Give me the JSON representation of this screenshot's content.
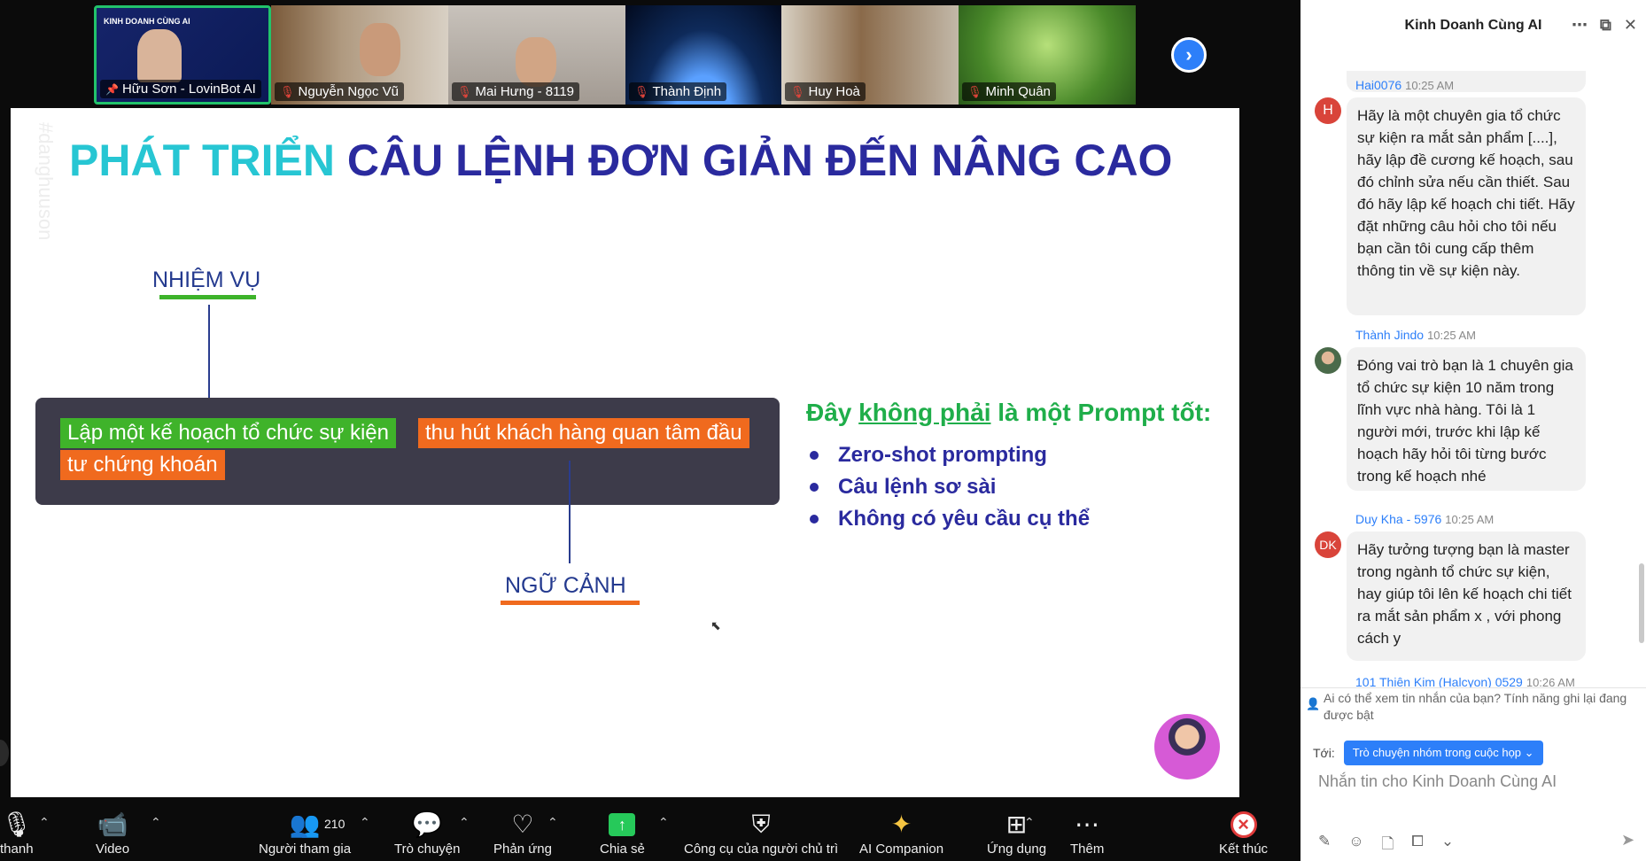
{
  "video_strip": {
    "participants": [
      {
        "name": "Hữu Sơn - LovinBot AI",
        "pinned": true,
        "muted": false,
        "bg": "#1a2a6a"
      },
      {
        "name": "Nguyễn Ngọc Vũ",
        "pinned": false,
        "muted": true,
        "bg": "#6b5b4a"
      },
      {
        "name": "Mai Hưng - 8119",
        "pinned": false,
        "muted": true,
        "bg": "#9a928a"
      },
      {
        "name": "Thành Định",
        "pinned": false,
        "muted": true,
        "bg": "#0e2a5a"
      },
      {
        "name": "Huy Hoà",
        "pinned": false,
        "muted": true,
        "bg": "#8a7a6a"
      },
      {
        "name": "Minh Quân",
        "pinned": false,
        "muted": true,
        "bg": "#4a8a2a"
      }
    ],
    "tile_logo": "KINH DOANH CÙNG AI"
  },
  "slide": {
    "watermark": "#danghuuson",
    "title_part1": "PHÁT TRIỂN",
    "title_part2": "CÂU LỆNH ĐƠN GIẢN ĐẾN NÂNG CAO",
    "label_task": "NHIỆM VỤ",
    "label_context": "NGỮ CẢNH",
    "highlight_task": "Lập một kế hoạch tổ chức sự kiện",
    "highlight_context_line1": "thu hút khách hàng quan tâm đầu",
    "highlight_context_line2": "tư chứng khoán",
    "prompt_heading_pre": "Đây",
    "prompt_heading_underlined": "không phải",
    "prompt_heading_post": "là một Prompt tốt:",
    "bullets": [
      "Zero-shot prompting",
      "Câu lệnh sơ sài",
      "Không có yêu cầu cụ thể"
    ]
  },
  "toolbar": {
    "audio": "thanh",
    "video": "Video",
    "participants": "Người tham gia",
    "participants_count": "210",
    "chat": "Trò chuyện",
    "reactions": "Phản ứng",
    "share": "Chia sẻ",
    "host_tools": "Công cụ của người chủ trì",
    "ai_companion": "AI Companion",
    "apps": "Ứng dụng",
    "more": "Thêm",
    "end": "Kết thúc"
  },
  "chat": {
    "title": "Kinh Doanh Cùng AI",
    "messages": [
      {
        "sender": "Hai0076",
        "time": "10:25 AM",
        "initials": "H",
        "avatar_color": "#d9443a",
        "text": "Hãy là một chuyên gia tổ chức sự kiện ra mắt sản phẩm [....], hãy lập đề cương kế hoạch, sau đó chỉnh sửa nếu cần thiết. Sau đó hãy lập kế hoạch chi tiết. Hãy đặt những câu hỏi cho tôi nếu bạn cần tôi cung cấp thêm thông tin về sự kiện này."
      },
      {
        "sender": "Thành Jindo",
        "time": "10:25 AM",
        "initials": "",
        "avatar_color": "#8a6a4a",
        "text": "Đóng vai trò bạn là 1 chuyên gia tổ chức sự kiện 10 năm trong lĩnh vực nhà hàng. Tôi là 1 người mới, trước khi lập kế hoạch hãy hỏi tôi từng bước trong kế hoạch nhé"
      },
      {
        "sender": "Duy Kha - 5976",
        "time": "10:25 AM",
        "initials": "DK",
        "avatar_color": "#d9443a",
        "text": "Hãy tưởng tượng bạn là master trong ngành tổ chức sự kiện, hay giúp tôi lên kế hoạch chi tiết ra mắt sản phẩm x , với phong cách y"
      },
      {
        "sender": "101 Thiên Kim (Halcyon) 0529",
        "time": "10:26 AM"
      }
    ],
    "privacy_notice": "Ai có thể xem tin nhắn của bạn? Tính năng ghi lại đang được bật",
    "to_label": "Tới:",
    "to_target": "Trò chuyện nhóm trong cuộc họp",
    "input_placeholder": "Nhắn tin cho Kinh Doanh Cùng AI"
  }
}
